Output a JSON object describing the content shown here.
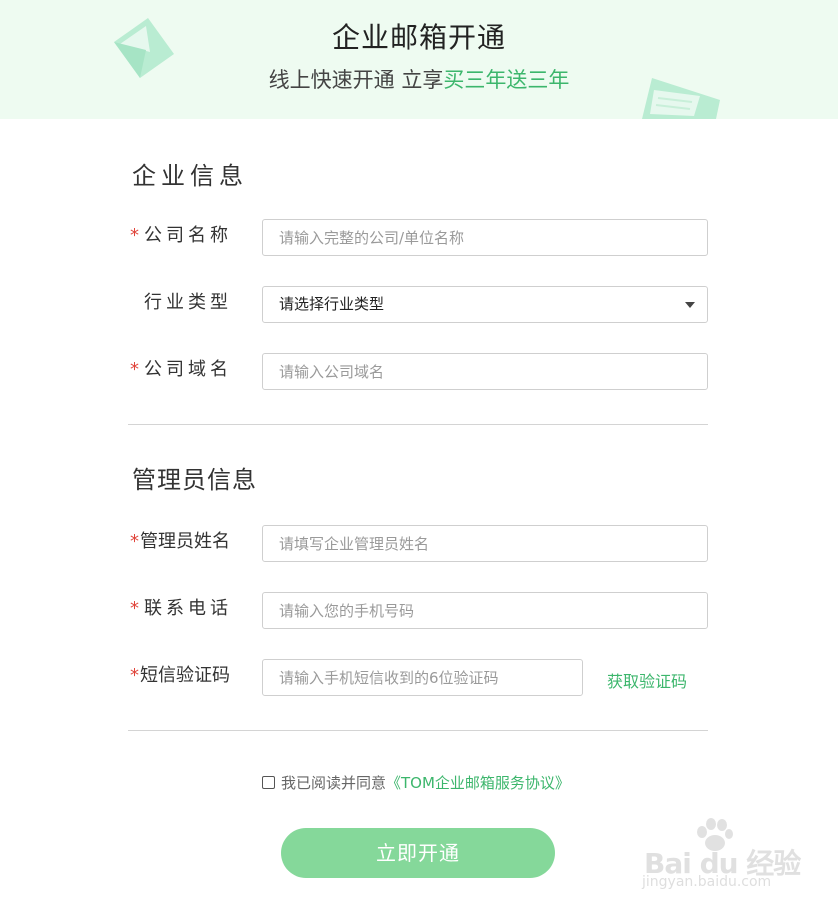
{
  "banner": {
    "title": "企业邮箱开通",
    "subtitle_plain": "线上快速开通 立享",
    "subtitle_highlight": "买三年送三年",
    "highlight_color": "#3cb66c",
    "background": "#eefbf1"
  },
  "company_section": {
    "title": "企业信息",
    "fields": {
      "company_name": {
        "required_mark": "*",
        "label": "公司名称",
        "placeholder": "请输入完整的公司/单位名称"
      },
      "industry": {
        "label": "行业类型",
        "selected": "请选择行业类型"
      },
      "domain": {
        "required_mark": "*",
        "label": "公司域名",
        "placeholder": "请输入公司域名"
      }
    }
  },
  "admin_section": {
    "title": "管理员信息",
    "fields": {
      "admin_name": {
        "required_mark": "*",
        "label": "管理员姓名",
        "placeholder": "请填写企业管理员姓名"
      },
      "phone": {
        "required_mark": "*",
        "label": "联系电话",
        "placeholder": "请输入您的手机号码"
      },
      "sms_code": {
        "required_mark": "*",
        "label": "短信验证码",
        "placeholder": "请输入手机短信收到的6位验证码",
        "get_code": "获取验证码"
      }
    }
  },
  "agreement": {
    "checked": false,
    "text": "我已阅读并同意",
    "link": "《TOM企业邮箱服务协议》"
  },
  "submit_label": "立即开通",
  "watermark": {
    "brand": "Bai du 经验",
    "url": "jingyan.baidu.com"
  },
  "colors": {
    "accent": "#3cb66c",
    "button": "#85d89a",
    "required": "#e0443a"
  },
  "icons": [
    "envelope-icon",
    "chevron-down-icon",
    "checkbox-icon"
  ]
}
